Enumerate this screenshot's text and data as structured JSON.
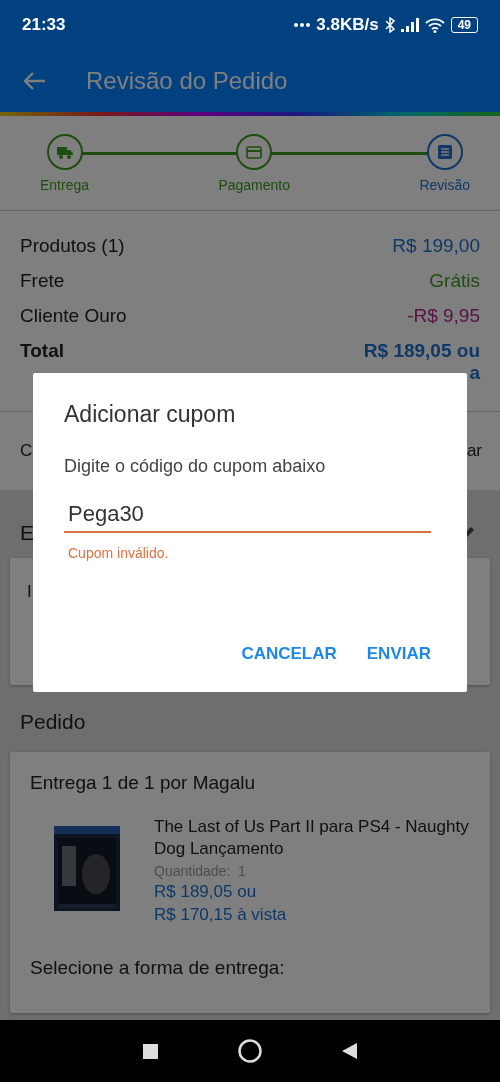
{
  "status_bar": {
    "time": "21:33",
    "speed": "3.8KB/s",
    "battery": "49"
  },
  "header": {
    "title": "Revisão do Pedido"
  },
  "steps": [
    {
      "label": "Entrega",
      "kind": "truck",
      "selected": false
    },
    {
      "label": "Pagamento",
      "kind": "card",
      "selected": false
    },
    {
      "label": "Revisão",
      "kind": "list",
      "selected": true
    }
  ],
  "summary": [
    {
      "label": "Produtos (1)",
      "value": "R$ 199,00",
      "kind": "price"
    },
    {
      "label": "Frete",
      "value": "Grátis",
      "kind": "free"
    },
    {
      "label": "Cliente Ouro",
      "value": "-R$ 9,95",
      "kind": "discount"
    }
  ],
  "total": {
    "label": "Total",
    "lines": [
      "R$ 189,05 ou",
      "a"
    ]
  },
  "coupon_row": {
    "label": "C",
    "action": "ar"
  },
  "address": {
    "heading": "E",
    "lines": [
      "I"
    ]
  },
  "order": {
    "heading": "Pedido",
    "delivery": "Entrega 1 de 1 por Magalu",
    "product": {
      "name": "The Last of Us Part II para PS4 - Naughty Dog Lançamento",
      "quantity_label": "Quantidade:",
      "quantity": "1",
      "price_lines": [
        "R$ 189,05 ou",
        "R$ 170,15 à vista"
      ]
    },
    "shipping_prompt": "Selecione a forma de entrega:"
  },
  "dialog": {
    "title": "Adicionar cupom",
    "message": "Digite o código do cupom abaixo",
    "field": {
      "value": "Pega30",
      "error": "Cupom inválido."
    },
    "buttons": [
      "CANCELAR",
      "ENVIAR"
    ]
  }
}
